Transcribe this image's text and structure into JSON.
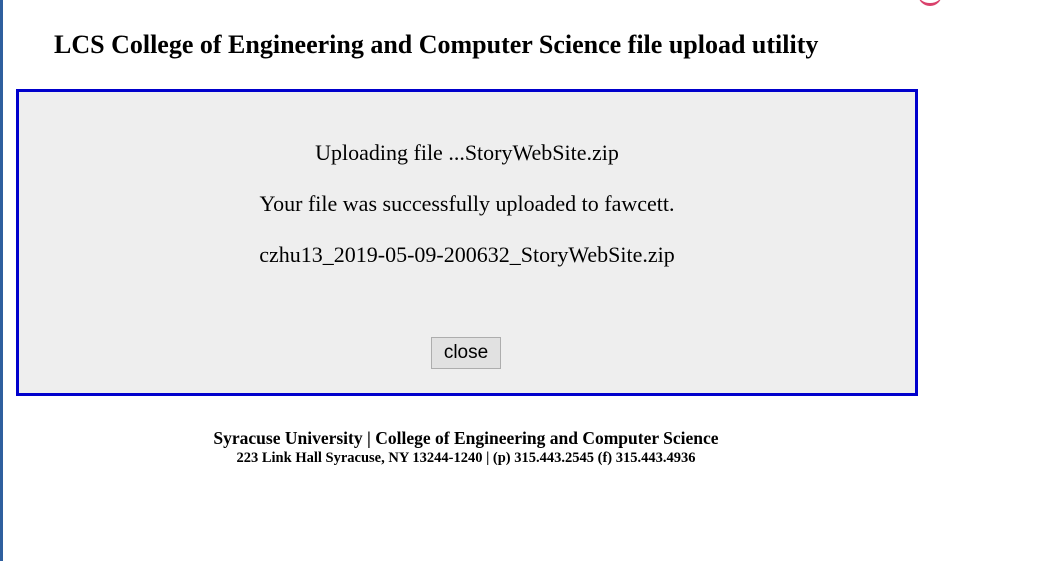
{
  "header": {
    "title": "LCS College of Engineering and Computer Science file upload utility"
  },
  "upload_panel": {
    "uploading_message": "Uploading file ...StoryWebSite.zip",
    "success_message": "Your file was successfully uploaded to fawcett.",
    "stored_filename": "czhu13_2019-05-09-200632_StoryWebSite.zip",
    "close_label": "close"
  },
  "footer": {
    "line1": "Syracuse University | College of Engineering and Computer Science",
    "line2": "223 Link Hall Syracuse, NY 13244-1240 | (p) 315.443.2545 (f) 315.443.4936"
  },
  "colors": {
    "panel_border": "#0000cc",
    "panel_background": "#eeeeee",
    "button_background": "#e1e1e1"
  }
}
